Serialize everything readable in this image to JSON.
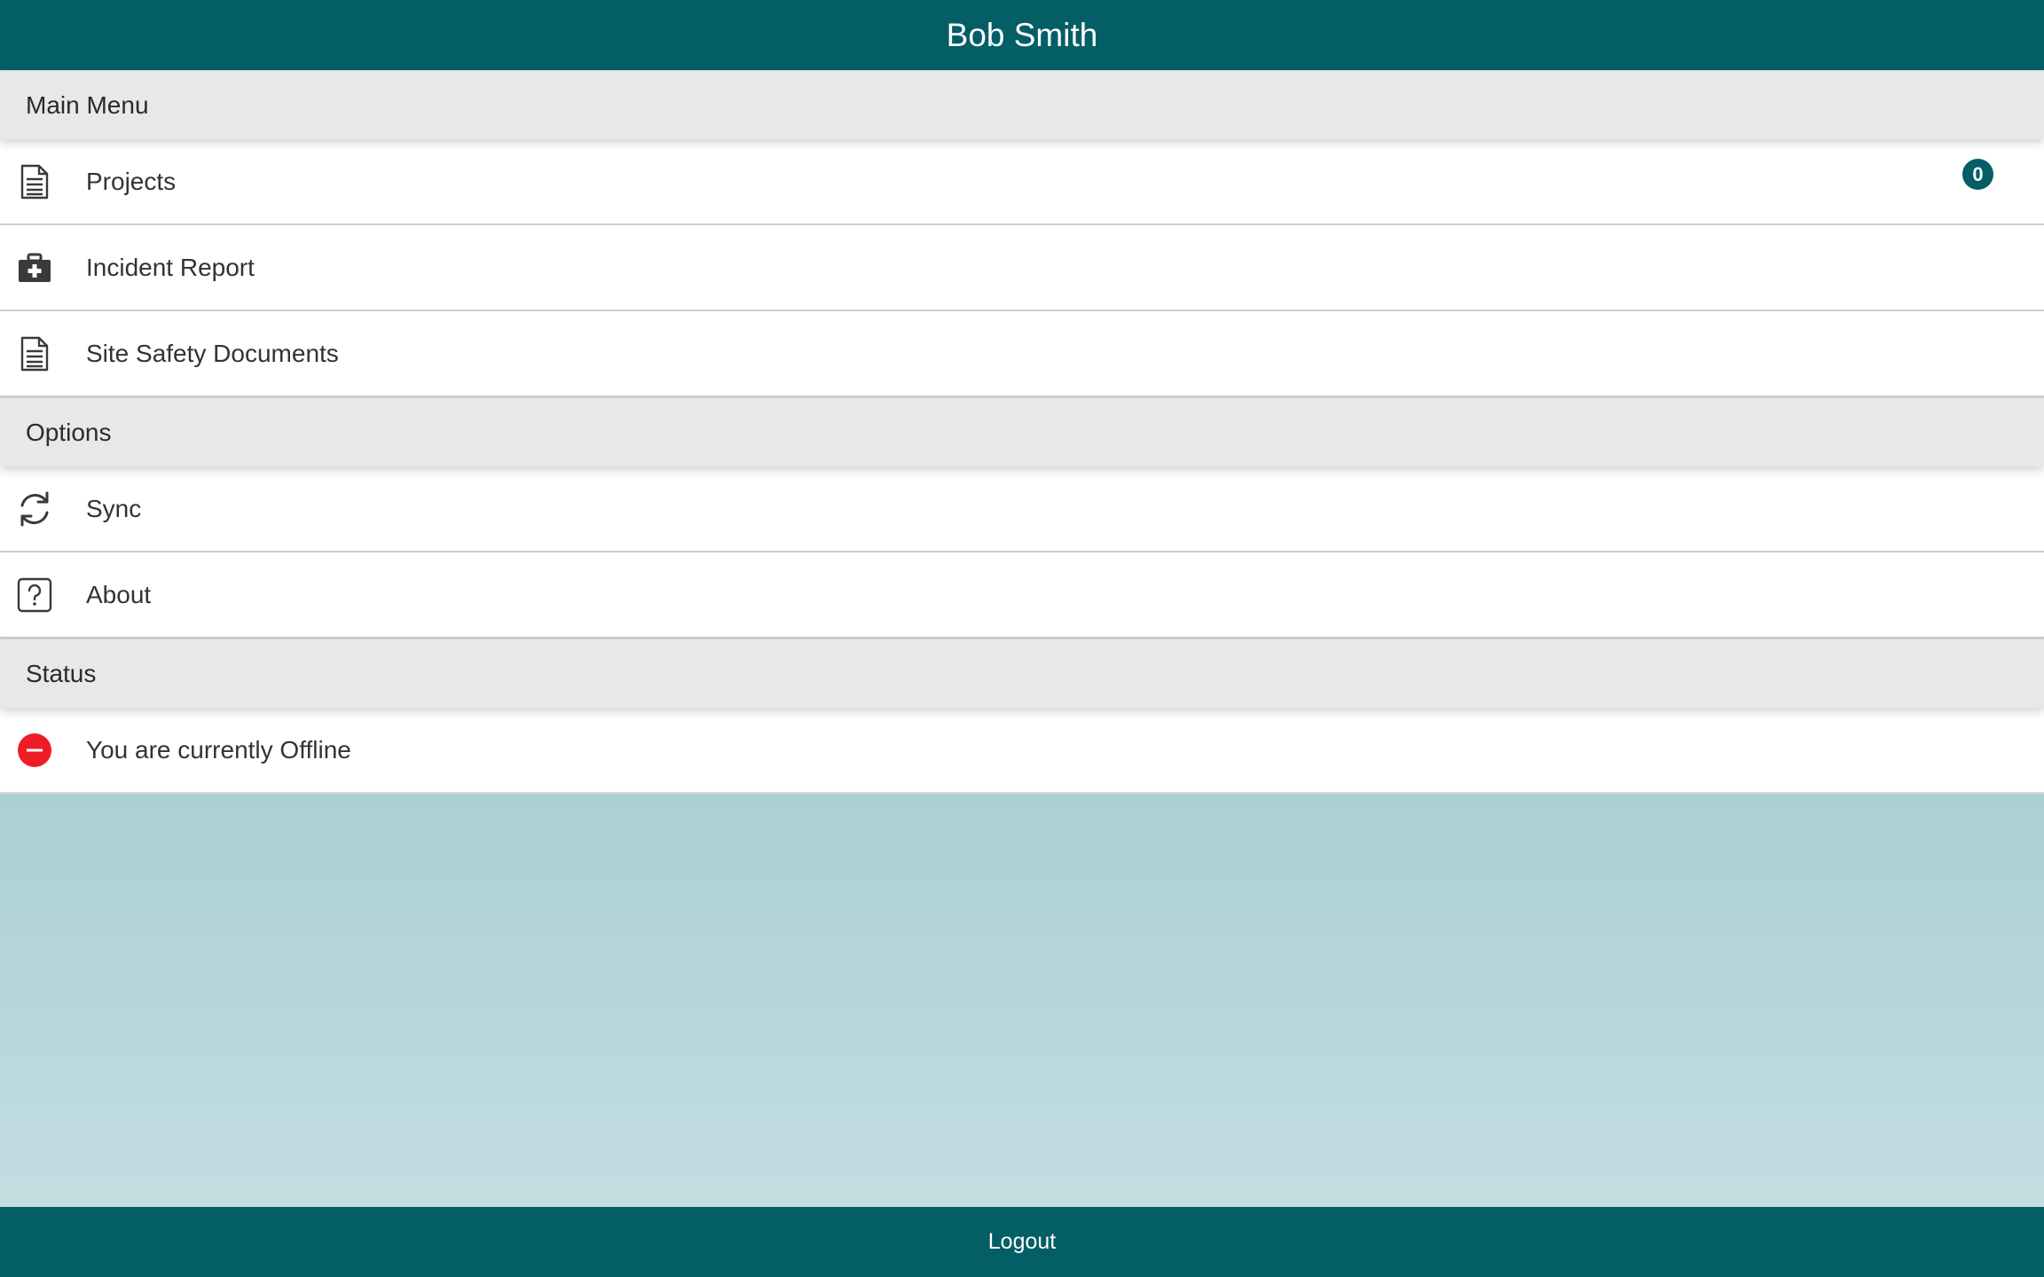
{
  "header": {
    "title": "Bob Smith"
  },
  "sections": {
    "main_menu": {
      "label": "Main Menu",
      "items": [
        {
          "label": "Projects",
          "icon": "document-icon",
          "badge": "0"
        },
        {
          "label": "Incident Report",
          "icon": "first-aid-kit-icon"
        },
        {
          "label": "Site Safety Documents",
          "icon": "document-icon"
        }
      ]
    },
    "options": {
      "label": "Options",
      "items": [
        {
          "label": "Sync",
          "icon": "sync-icon"
        },
        {
          "label": "About",
          "icon": "question-icon"
        }
      ]
    },
    "status": {
      "label": "Status",
      "items": [
        {
          "label": "You are currently Offline",
          "icon": "offline-icon"
        }
      ]
    }
  },
  "footer": {
    "logout_label": "Logout"
  },
  "colors": {
    "brand": "#035e66",
    "section_bg": "#e8e8e8",
    "offline": "#ee1c25",
    "backdrop_top": "#aacfd5",
    "backdrop_bottom": "#c3dde1"
  }
}
